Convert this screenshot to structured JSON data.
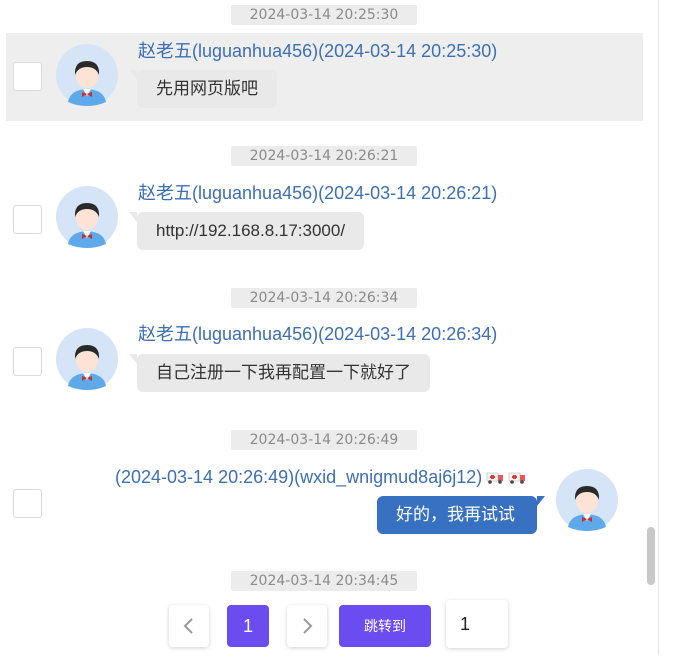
{
  "timestamps": [
    "2024-03-14 20:25:30",
    "2024-03-14 20:26:21",
    "2024-03-14 20:26:34",
    "2024-03-14 20:26:49",
    "2024-03-14 20:34:45"
  ],
  "messages": [
    {
      "sender": "赵老五(luguanhua456)(2024-03-14 20:25:30)",
      "text": "先用网页版吧"
    },
    {
      "sender": "赵老五(luguanhua456)(2024-03-14 20:26:21)",
      "text": "http://192.168.8.17:3000/"
    },
    {
      "sender": "赵老五(luguanhua456)(2024-03-14 20:26:34)",
      "text": "自己注册一下我再配置一下就好了"
    },
    {
      "sender": "(2024-03-14 20:26:49)(wxid_wnigmud8aj6j12)",
      "text": "好的，我再试试"
    }
  ],
  "pagination": {
    "prev_icon": "chevron-left-icon",
    "current_page": "1",
    "next_icon": "chevron-right-icon",
    "jump_label": "跳转到",
    "jump_value": "1"
  },
  "colors": {
    "accent": "#6b4cf0",
    "sender": "#3d6fb5",
    "self_bubble": "#3871c1",
    "highlight_row": "#eeeeee"
  }
}
